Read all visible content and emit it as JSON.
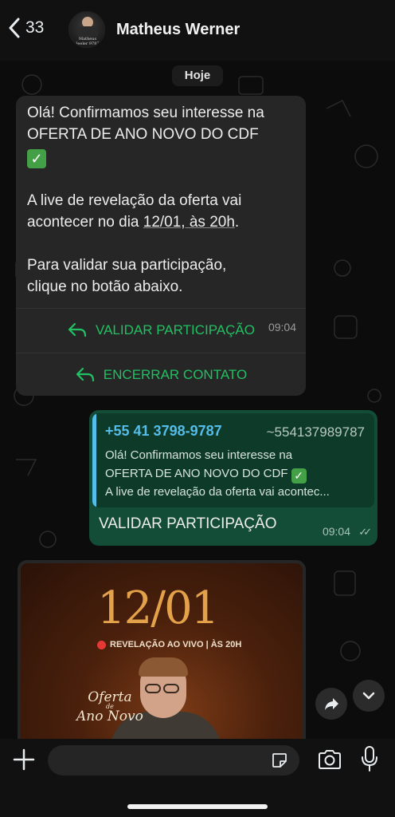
{
  "header": {
    "back_count": "33",
    "contact_name": "Matheus Werner",
    "avatar_caption": "Matheus Jeeler 9787"
  },
  "chat": {
    "date_label": "Hoje",
    "incoming": {
      "line1": "Olá! Confirmamos seu interesse na OFERTA DE ANO NOVO DO CDF",
      "line2_prefix": "A live de revelação da oferta vai acontecer no dia ",
      "line2_date": "12/01, às 20h",
      "line2_suffix": ".",
      "line3": "Para validar sua participação, clique no botão abaixo.",
      "time": "09:04",
      "buttons": [
        {
          "label": "VALIDAR PARTICIPAÇÃO",
          "icon": "reply-icon"
        },
        {
          "label": "ENCERRAR CONTATO",
          "icon": "reply-icon"
        }
      ]
    },
    "outgoing": {
      "quote_phone": "+55 41 3798-9787",
      "quote_alias": "~554137989787",
      "quote_line1": "Olá! Confirmamos seu interesse na",
      "quote_line2": "OFERTA DE ANO NOVO DO CDF",
      "quote_line3": "A live de revelação da oferta vai acontec...",
      "text": "VALIDAR PARTICIPAÇÃO",
      "time": "09:04",
      "status": "read"
    },
    "image_message": {
      "date": "12/01",
      "live_text": "REVELAÇÃO AO VIVO | ÀS 20H",
      "logo_line1": "Oferta",
      "logo_line2": "de",
      "logo_line3": "Ano Novo"
    }
  },
  "colors": {
    "accent_green": "#21c063",
    "outgoing_bubble": "#144d37",
    "quote_blue": "#53bdeb"
  }
}
